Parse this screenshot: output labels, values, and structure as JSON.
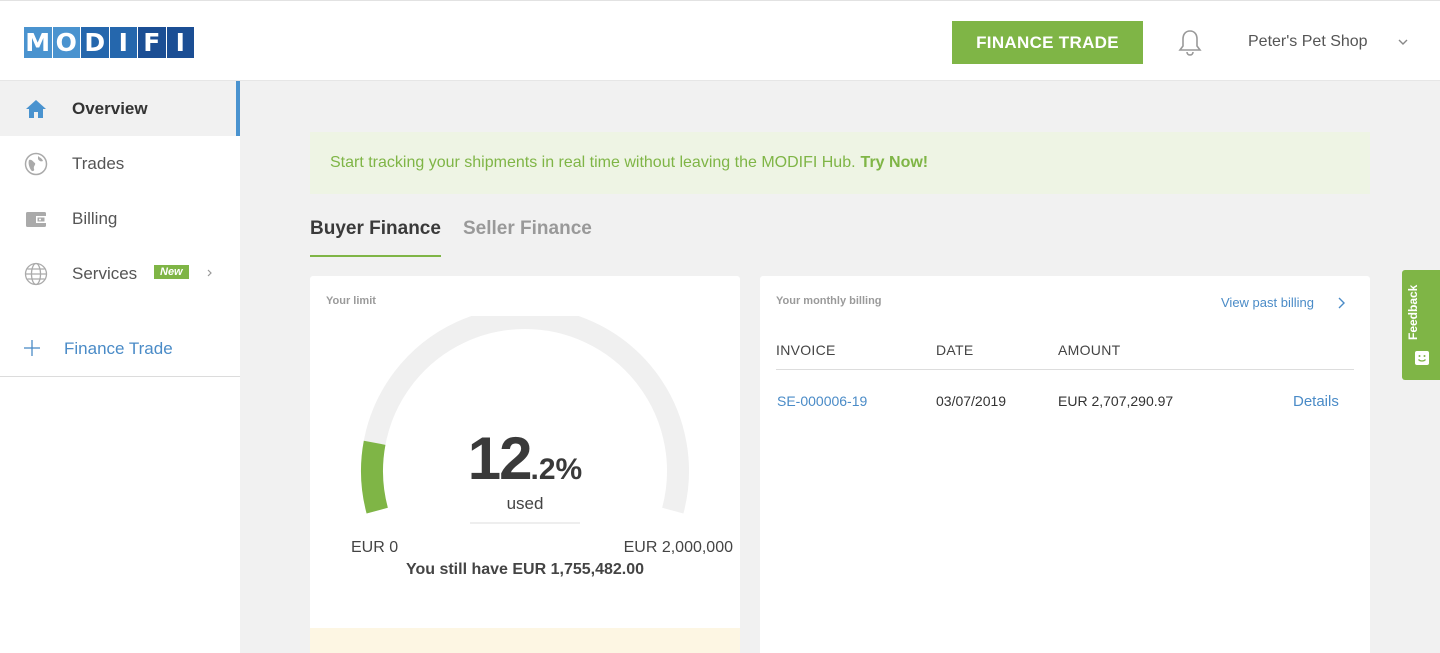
{
  "header": {
    "logo_letters": [
      "M",
      "O",
      "D",
      "I",
      "F",
      "I"
    ],
    "finance_trade_button": "FINANCE TRADE",
    "account_name": "Peter's Pet Shop",
    "icons": [
      "bell-icon",
      "chevron-down-icon"
    ]
  },
  "sidebar": {
    "items": [
      {
        "label": "Overview",
        "icon": "home-icon",
        "active": true
      },
      {
        "label": "Trades",
        "icon": "globe-icon",
        "active": false
      },
      {
        "label": "Billing",
        "icon": "wallet-icon",
        "active": false
      },
      {
        "label": "Services",
        "icon": "world-icon",
        "active": false,
        "badge": "New"
      }
    ],
    "finance_trade_link": "Finance Trade"
  },
  "banner": {
    "text": "Start tracking your shipments in real time without leaving the MODIFI Hub.",
    "cta": "Try Now!"
  },
  "tabs": [
    {
      "label": "Buyer Finance",
      "active": true
    },
    {
      "label": "Seller Finance",
      "active": false
    }
  ],
  "limit_card": {
    "title": "Your limit",
    "percent_whole": "12",
    "percent_decimal": ".2%",
    "used_fraction": 0.122,
    "used_label": "used",
    "min_label": "EUR 0",
    "max_label": "EUR 2,000,000",
    "remaining": "You still have EUR 1,755,482.00"
  },
  "billing_card": {
    "title": "Your monthly billing",
    "view_past": "View past billing",
    "columns": [
      "INVOICE",
      "DATE",
      "AMOUNT"
    ],
    "rows": [
      {
        "invoice": "SE-000006-19",
        "date": "03/07/2019",
        "amount": "EUR 2,707,290.97",
        "action": "Details"
      }
    ]
  },
  "feedback_tab": "Feedback",
  "colors": {
    "brand_green": "#7fb546",
    "brand_blue": "#4a93cf",
    "link_blue": "#4a8bc7"
  }
}
